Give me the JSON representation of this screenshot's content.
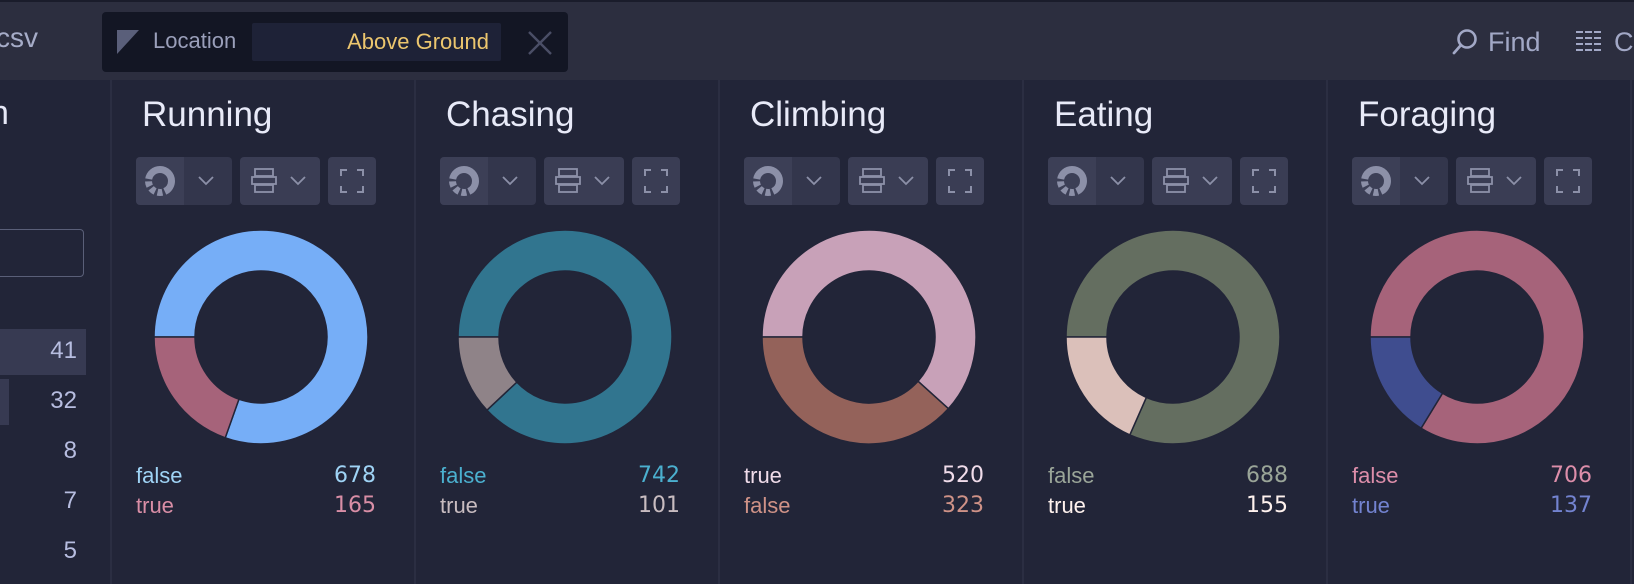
{
  "header": {
    "file_suffix": "csv",
    "filter": {
      "icon": "column-filter-triangle-icon",
      "label": "Location",
      "value": "Above Ground",
      "close_icon": "close-icon"
    },
    "find": {
      "icon": "search-icon",
      "label": "Find"
    },
    "columns": {
      "icon": "columns-grid-icon",
      "label": "C"
    }
  },
  "left_column": {
    "title_fragment": "n",
    "counts": [
      "41",
      "32",
      "8",
      "7",
      "5"
    ],
    "highlight_fraction": [
      1.0,
      0.1,
      0,
      0,
      0
    ]
  },
  "controls": {
    "chart_type_icon": "donut-chart-icon",
    "dropdown_icon": "chevron-down-icon",
    "layout_icon": "layout-rows-icon",
    "expand_icon": "expand-icon"
  },
  "chart_data": [
    {
      "type": "pie",
      "title": "Running",
      "slices": [
        {
          "label": "false",
          "value": 678,
          "color": "#76aef7",
          "text_color": "#9fd3f5"
        },
        {
          "label": "true",
          "value": 165,
          "color": "#a6637a",
          "text_color": "#d98ea6"
        }
      ]
    },
    {
      "type": "pie",
      "title": "Chasing",
      "slices": [
        {
          "label": "false",
          "value": 742,
          "color": "#31758f",
          "text_color": "#4bb0cf"
        },
        {
          "label": "true",
          "value": 101,
          "color": "#8f8388",
          "text_color": "#c8bcc0"
        }
      ]
    },
    {
      "type": "pie",
      "title": "Climbing",
      "slices": [
        {
          "label": "true",
          "value": 520,
          "color": "#c8a1b8",
          "text_color": "#f0dcea"
        },
        {
          "label": "false",
          "value": 323,
          "color": "#94625a",
          "text_color": "#cf9287"
        }
      ]
    },
    {
      "type": "pie",
      "title": "Eating",
      "slices": [
        {
          "label": "false",
          "value": 688,
          "color": "#646e60",
          "text_color": "#9aa598"
        },
        {
          "label": "true",
          "value": 155,
          "color": "#dbc0ba",
          "text_color": "#fff2ee"
        }
      ]
    },
    {
      "type": "pie",
      "title": "Foraging",
      "slices": [
        {
          "label": "false",
          "value": 706,
          "color": "#a6637a",
          "text_color": "#dd8eaa"
        },
        {
          "label": "true",
          "value": 137,
          "color": "#3f4d8f",
          "text_color": "#7383d0"
        }
      ]
    }
  ]
}
